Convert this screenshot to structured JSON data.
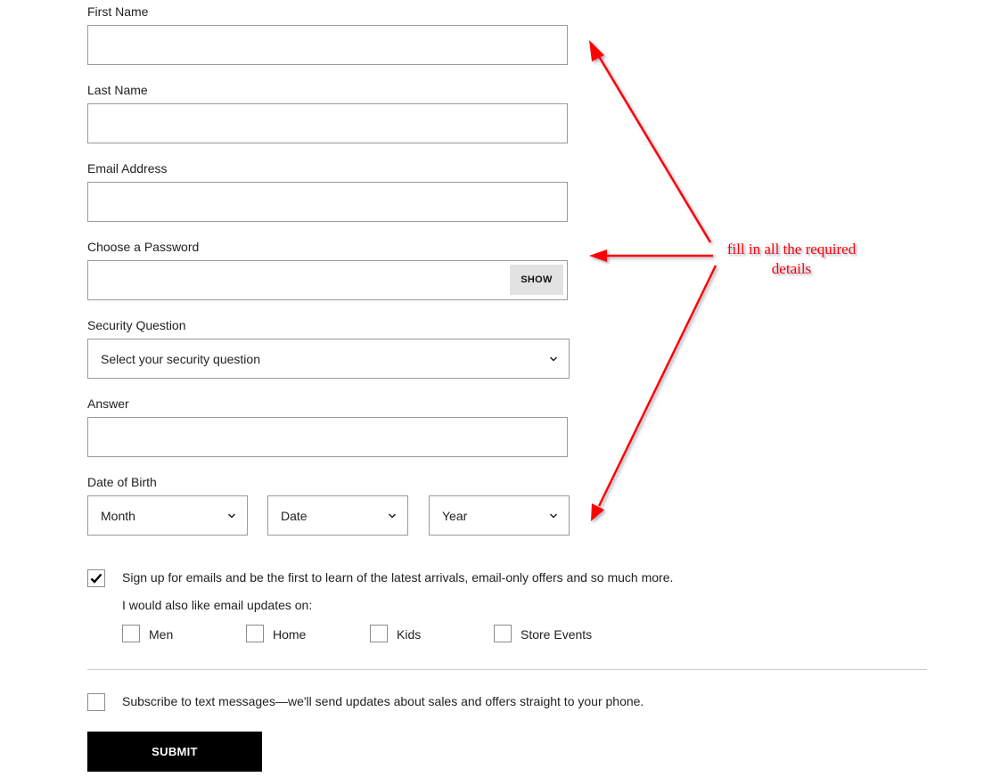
{
  "form": {
    "first_name": {
      "label": "First Name",
      "value": ""
    },
    "last_name": {
      "label": "Last Name",
      "value": ""
    },
    "email": {
      "label": "Email Address",
      "value": ""
    },
    "password": {
      "label": "Choose a Password",
      "value": "",
      "show_label": "SHOW"
    },
    "security_question": {
      "label": "Security Question",
      "selected": "Select your security question"
    },
    "answer": {
      "label": "Answer",
      "value": ""
    },
    "dob": {
      "label": "Date of Birth",
      "month": "Month",
      "date": "Date",
      "year": "Year"
    },
    "email_signup": {
      "checked": true,
      "text": "Sign up for emails and be the first to learn of the latest arrivals, email-only offers and so much more.",
      "updates_label": "I would also like email updates on:",
      "options": [
        {
          "label": "Men",
          "checked": false
        },
        {
          "label": "Home",
          "checked": false
        },
        {
          "label": "Kids",
          "checked": false
        },
        {
          "label": "Store Events",
          "checked": false
        }
      ]
    },
    "sms_signup": {
      "checked": false,
      "text": "Subscribe to text messages—we'll send updates about sales and offers straight to your phone."
    },
    "submit_label": "SUBMIT"
  },
  "annotation": {
    "line1": "fill in all the required",
    "line2": "details",
    "color": "#ff0000"
  }
}
